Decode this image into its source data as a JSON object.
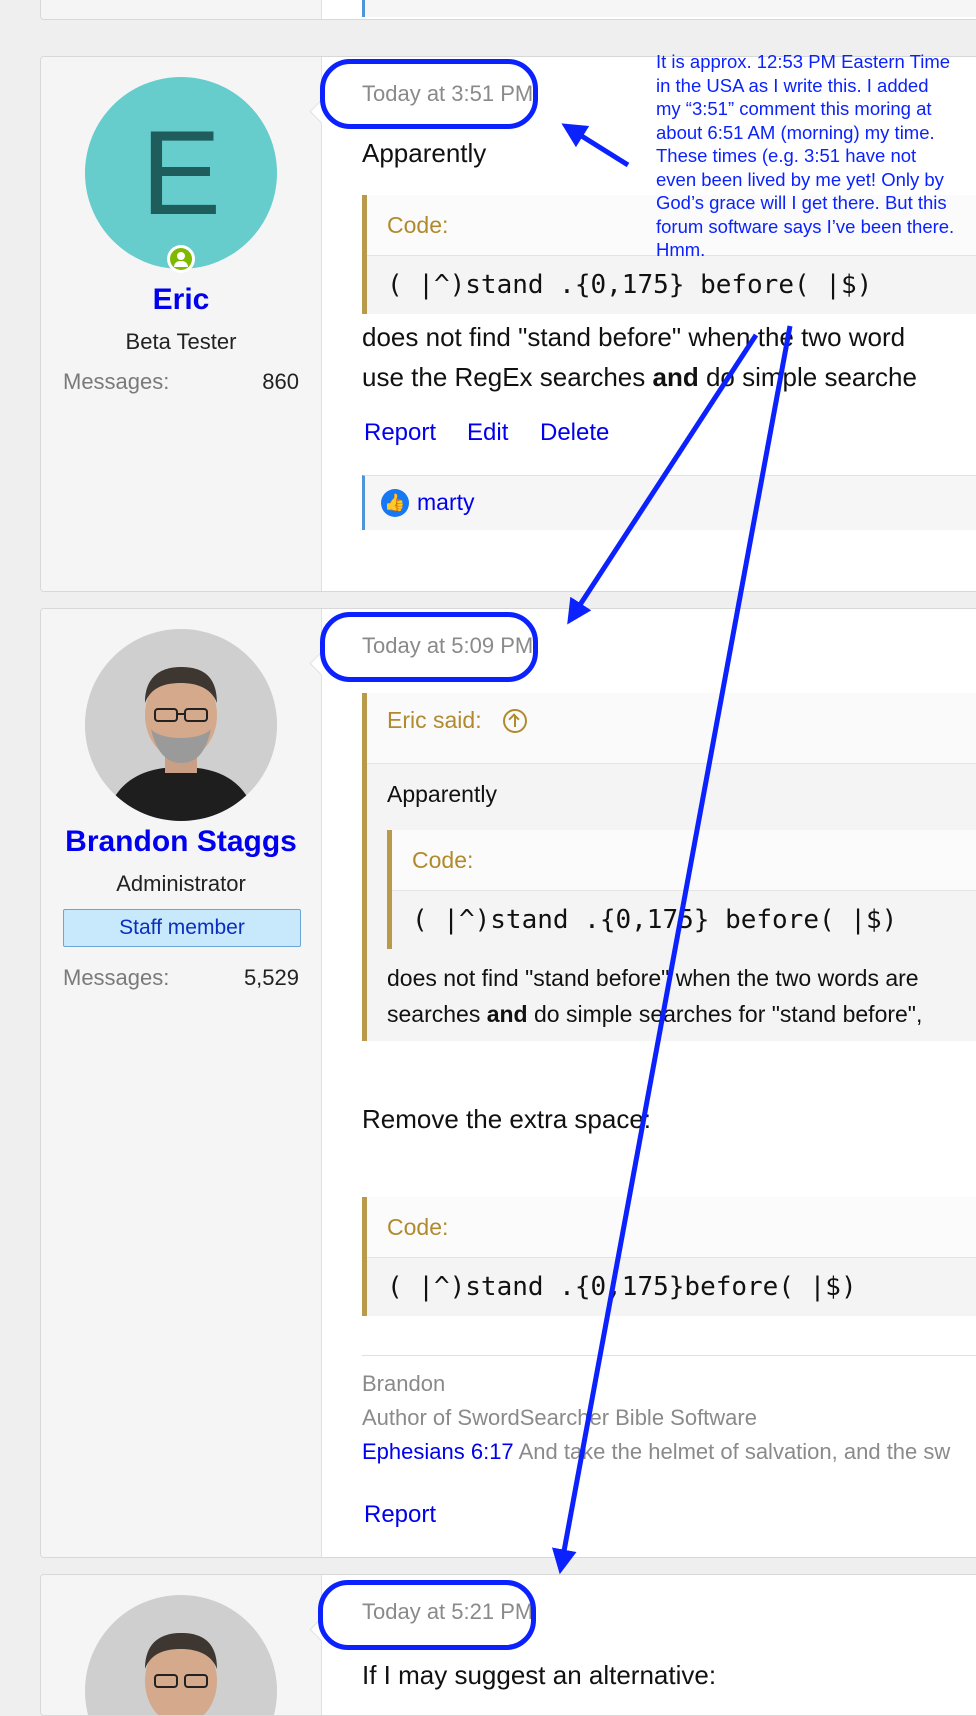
{
  "posts": [
    {
      "author": "Eric",
      "avatar_letter": "E",
      "user_title": "Beta Tester",
      "messages_label": "Messages:",
      "messages_count": "860",
      "timestamp": "Today at 3:51 PM",
      "intro": "Apparently",
      "code_label": "Code:",
      "code": "( |^)stand .{0,175} before( |$)",
      "body_line1": "does not find \"stand before\" when the two word",
      "body_line2_a": "use the RegEx searches ",
      "body_line2_bold": "and",
      "body_line2_b": " do simple searche",
      "actions": [
        "Report",
        "Edit",
        "Delete"
      ],
      "reaction_user": "marty"
    },
    {
      "author": "Brandon Staggs",
      "user_title": "Administrator",
      "staff_badge": "Staff member",
      "messages_label": "Messages:",
      "messages_count": "5,529",
      "timestamp": "Today at 5:09 PM",
      "quote_title": "Eric said:",
      "quote_intro": "Apparently",
      "quote_code_label": "Code:",
      "quote_code": "( |^)stand .{0,175} before( |$)",
      "quote_line1": "does not find \"stand before\" when the two words are",
      "quote_line2_a": "searches ",
      "quote_line2_bold": "and",
      "quote_line2_b": " do simple searches for \"stand before\",",
      "reply": "Remove the extra space:",
      "code_label": "Code:",
      "code": "( |^)stand .{0,175}before( |$)",
      "sig_name": "Brandon",
      "sig_role": "Author of SwordSearcher Bible Software",
      "sig_verse_ref": "Ephesians 6:17",
      "sig_verse_text": " And take the helmet of salvation, and the sw",
      "actions": [
        "Report"
      ]
    },
    {
      "timestamp": "Today at 5:21 PM",
      "intro": "If I may suggest an alternative:"
    }
  ],
  "annotation": "It is approx. 12:53 PM Eastern Time in the USA as I write this. I added my “3:51” comment this moring at about 6:51 AM (morning) my time. These times (e.g. 3:51 have not even been lived by me yet! Only by God’s grace will I get there. But this forum software says I’ve been there. Hmm.",
  "colors": {
    "annotation_blue": "#0b22ff",
    "username_blue": "#0000ee",
    "code_label_gold": "#b18a2e",
    "eric_avatar": "#66cccc"
  }
}
